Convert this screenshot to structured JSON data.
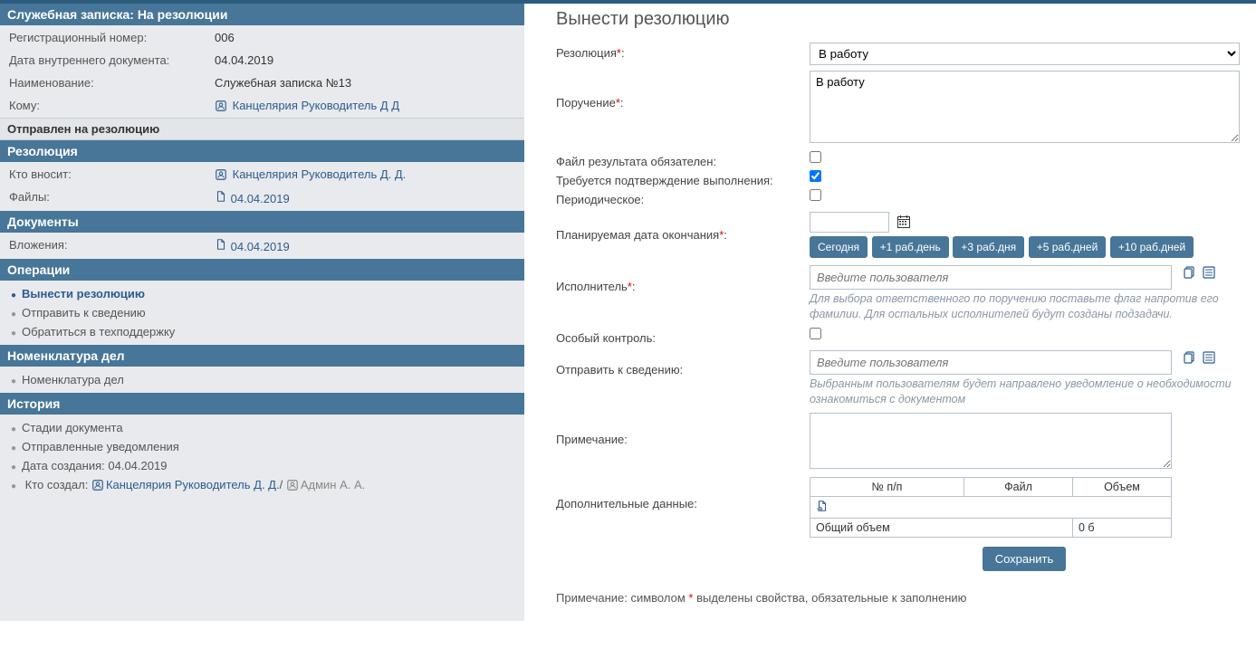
{
  "left": {
    "header": "Служебная записка: На резолюции",
    "info": {
      "reg_num_label": "Регистрационный номер:",
      "reg_num": "006",
      "doc_date_label": "Дата внутреннего документа:",
      "doc_date": "04.04.2019",
      "name_label": "Наименование:",
      "name": "Служебная записка №13",
      "to_label": "Кому:",
      "to": "Канцелярия Руководитель Д Д"
    },
    "sent_header": "Отправлен на резолюцию",
    "resolution_header": "Резолюция",
    "resolution": {
      "who_label": "Кто вносит:",
      "who": "Канцелярия Руководитель Д. Д.",
      "files_label": "Файлы:",
      "files": "04.04.2019"
    },
    "documents_header": "Документы",
    "documents": {
      "attachments_label": "Вложения:",
      "attachments": "04.04.2019"
    },
    "operations_header": "Операции",
    "operations": [
      {
        "label": "Вынести резолюцию",
        "active": true
      },
      {
        "label": "Отправить к сведению",
        "active": false
      },
      {
        "label": "Обратиться в техподдержку",
        "active": false
      }
    ],
    "nomenclature_header": "Номенклатура дел",
    "nomenclature": [
      {
        "label": "Номенклатура дел"
      }
    ],
    "history_header": "История",
    "history": {
      "stages": "Стадии документа",
      "notifications": "Отправленные уведомления",
      "created_date": "Дата создания: 04.04.2019",
      "created_by_label": "Кто создал:",
      "created_by_1": "Канцелярия Руководитель Д. Д.",
      "created_by_sep": "/",
      "created_by_2": "Админ А. А."
    }
  },
  "right": {
    "title": "Вынести резолюцию",
    "resolution_label": "Резолюция",
    "resolution_select": "В работу",
    "assignment_label": "Поручение",
    "assignment_text": "В работу",
    "file_required_label": "Файл результата обязателен:",
    "confirm_label": "Требуется подтверждение выполнения:",
    "periodic_label": "Периодическое:",
    "planned_date_label": "Планируемая дата окончания",
    "date_btns": [
      "Сегодня",
      "+1 раб.день",
      "+3 раб.дня",
      "+5 раб.дней",
      "+10 раб.дней"
    ],
    "executor_label": "Исполнитель",
    "user_placeholder": "Введите пользователя",
    "executor_hint": "Для выбора ответственного по поручению поставьте флаг напротив его фамилии. Для остальных исполнителей будут созданы подзадачи.",
    "special_control_label": "Особый контроль:",
    "send_info_label": "Отправить к сведению:",
    "send_info_hint": "Выбранным пользователям будет направлено уведомление о необходимости ознакомиться с документом",
    "note_label": "Примечание:",
    "additional_label": "Дополнительные данные:",
    "add_table": {
      "h1": "№ п/п",
      "h2": "Файл",
      "h3": "Объем",
      "total_label": "Общий объем",
      "total_val": "0 б"
    },
    "save_btn": "Сохранить",
    "footnote_1": "Примечание: символом ",
    "footnote_2": " выделены свойства, обязательные к заполнению"
  }
}
